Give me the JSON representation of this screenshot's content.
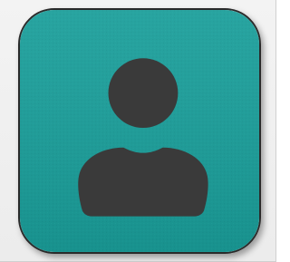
{
  "app": {
    "title": ""
  },
  "icon": {
    "name": "user-avatar-icon",
    "background_color": "#1a9e9a",
    "glyph_color": "#3a3a3a",
    "border_color": "#2a2a2a"
  }
}
